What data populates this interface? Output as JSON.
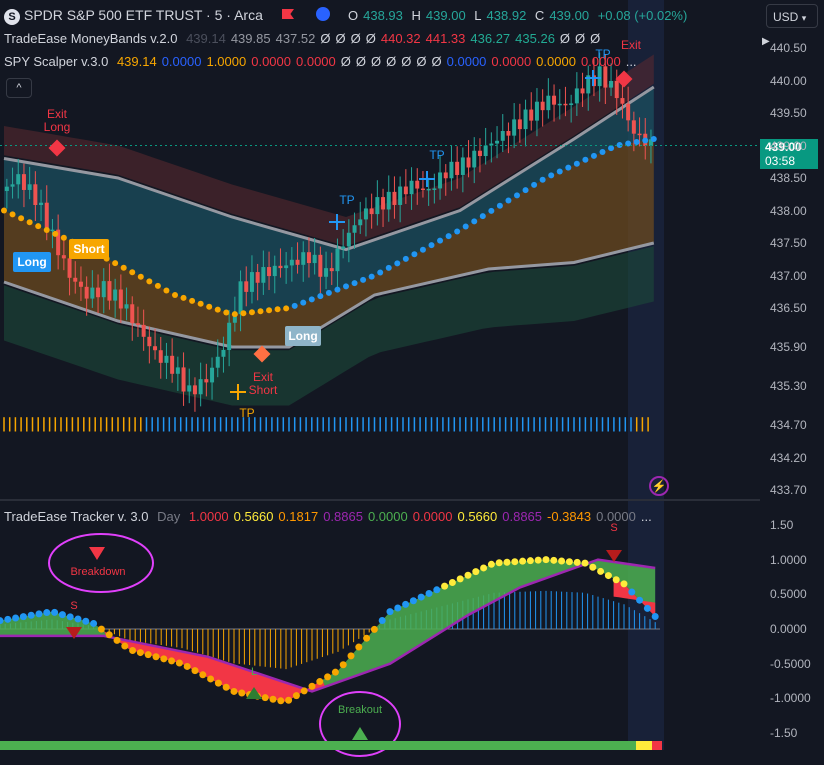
{
  "header": {
    "symbol_logo": "S",
    "symbol_title": "SPDR S&P 500 ETF TRUST · 5 · Arca",
    "ohlc": [
      {
        "key": "O",
        "value": "438.93"
      },
      {
        "key": "H",
        "value": "439.00"
      },
      {
        "key": "L",
        "value": "438.92"
      },
      {
        "key": "C",
        "value": "439.00"
      }
    ],
    "change": "+0.08 (+0.02%)"
  },
  "indicators": [
    {
      "name": "TradeEase MoneyBands v.2.0",
      "values": [
        {
          "text": "439.14",
          "color": "#4b4f5c"
        },
        {
          "text": "439.85",
          "color": "#9598a1"
        },
        {
          "text": "437.52",
          "color": "#9598a1"
        },
        {
          "text": "Ø",
          "color": "#d1d4dc"
        },
        {
          "text": "Ø",
          "color": "#d1d4dc"
        },
        {
          "text": "Ø",
          "color": "#d1d4dc"
        },
        {
          "text": "Ø",
          "color": "#d1d4dc"
        },
        {
          "text": "440.32",
          "color": "#f23645"
        },
        {
          "text": "441.33",
          "color": "#f23645"
        },
        {
          "text": "436.27",
          "color": "#22ab94"
        },
        {
          "text": "435.26",
          "color": "#22ab94"
        },
        {
          "text": "Ø",
          "color": "#d1d4dc"
        },
        {
          "text": "Ø",
          "color": "#d1d4dc"
        },
        {
          "text": "Ø",
          "color": "#d1d4dc"
        }
      ]
    },
    {
      "name": "SPY Scalper v.3.0",
      "values": [
        {
          "text": "439.14",
          "color": "#f7a600"
        },
        {
          "text": "0.0000",
          "color": "#2962ff"
        },
        {
          "text": "1.0000",
          "color": "#f7a600"
        },
        {
          "text": "0.0000",
          "color": "#f23645"
        },
        {
          "text": "0.0000",
          "color": "#f23645"
        },
        {
          "text": "Ø",
          "color": "#d1d4dc"
        },
        {
          "text": "Ø",
          "color": "#d1d4dc"
        },
        {
          "text": "Ø",
          "color": "#d1d4dc"
        },
        {
          "text": "Ø",
          "color": "#d1d4dc"
        },
        {
          "text": "Ø",
          "color": "#d1d4dc"
        },
        {
          "text": "Ø",
          "color": "#d1d4dc"
        },
        {
          "text": "Ø",
          "color": "#d1d4dc"
        },
        {
          "text": "0.0000",
          "color": "#2962ff"
        },
        {
          "text": "0.0000",
          "color": "#f23645"
        },
        {
          "text": "0.0000",
          "color": "#f7a600"
        },
        {
          "text": "0.0000",
          "color": "#f23645"
        },
        {
          "text": "...",
          "color": "#d1d4dc"
        }
      ]
    },
    {
      "name": "TradeEase Tracker v. 3.0",
      "timeframe": "Day",
      "values": [
        {
          "text": "1.0000",
          "color": "#f23645"
        },
        {
          "text": "0.5660",
          "color": "#ffeb3b"
        },
        {
          "text": "0.1817",
          "color": "#ff9800"
        },
        {
          "text": "0.8865",
          "color": "#9c27b0"
        },
        {
          "text": "0.0000",
          "color": "#4caf50"
        },
        {
          "text": "0.0000",
          "color": "#f23645"
        },
        {
          "text": "0.5660",
          "color": "#ffeb3b"
        },
        {
          "text": "0.8865",
          "color": "#9c27b0"
        },
        {
          "text": "-0.3843",
          "color": "#ff9800"
        },
        {
          "text": "0.0000",
          "color": "#787b86"
        },
        {
          "text": "...",
          "color": "#d1d4dc"
        }
      ]
    }
  ],
  "currency_button": "USD",
  "collapse_button": "^",
  "last_price": {
    "value": "439.00",
    "countdown": "03:58"
  },
  "chart_data": [
    {
      "type": "candlestick",
      "title": "SPDR S&P 500 ETF TRUST · 5 · Arca",
      "ylim": [
        433.7,
        440.5
      ],
      "price_ticks": [
        "440.50",
        "440.00",
        "439.50",
        "439.00",
        "438.50",
        "438.00",
        "437.50",
        "437.00",
        "436.50",
        "435.90",
        "435.30",
        "434.70",
        "434.20",
        "433.70"
      ],
      "price_tick_values": [
        440.5,
        440.0,
        439.5,
        439.0,
        438.5,
        438.0,
        437.5,
        437.0,
        436.5,
        435.9,
        435.3,
        434.7,
        434.2,
        433.7
      ],
      "close_path": [
        [
          0,
          438.3
        ],
        [
          6,
          438.5
        ],
        [
          12,
          438.2
        ],
        [
          18,
          437.6
        ],
        [
          24,
          437.0
        ],
        [
          30,
          436.7
        ],
        [
          36,
          436.8
        ],
        [
          42,
          436.6
        ],
        [
          48,
          436.2
        ],
        [
          54,
          435.8
        ],
        [
          60,
          435.6
        ],
        [
          66,
          435.2
        ],
        [
          72,
          435.4
        ],
        [
          78,
          435.9
        ],
        [
          84,
          436.8
        ],
        [
          90,
          437.0
        ],
        [
          96,
          437.1
        ],
        [
          102,
          437.2
        ],
        [
          108,
          437.3
        ],
        [
          114,
          437.0
        ],
        [
          120,
          437.5
        ],
        [
          126,
          437.9
        ],
        [
          132,
          438.1
        ],
        [
          138,
          438.2
        ],
        [
          144,
          438.4
        ],
        [
          150,
          438.3
        ],
        [
          156,
          438.6
        ],
        [
          162,
          438.7
        ],
        [
          168,
          438.9
        ],
        [
          174,
          439.1
        ],
        [
          180,
          439.3
        ],
        [
          186,
          439.5
        ],
        [
          192,
          439.7
        ],
        [
          198,
          439.6
        ],
        [
          204,
          439.9
        ],
        [
          210,
          440.1
        ],
        [
          216,
          439.8
        ],
        [
          222,
          439.2
        ],
        [
          228,
          439.0
        ]
      ],
      "ribbon_upper": [
        [
          0,
          438.8
        ],
        [
          40,
          438.5
        ],
        [
          80,
          437.9
        ],
        [
          120,
          437.4
        ],
        [
          160,
          438.0
        ],
        [
          200,
          439.1
        ],
        [
          228,
          439.9
        ]
      ],
      "ribbon_lower": [
        [
          0,
          436.9
        ],
        [
          40,
          436.3
        ],
        [
          80,
          435.9
        ],
        [
          100,
          435.9
        ],
        [
          130,
          436.7
        ],
        [
          170,
          437.1
        ],
        [
          200,
          437.2
        ],
        [
          228,
          437.5
        ]
      ],
      "dots_series": [
        [
          0,
          438.0
        ],
        [
          30,
          437.4
        ],
        [
          60,
          436.7
        ],
        [
          80,
          436.4
        ],
        [
          100,
          436.5
        ],
        [
          130,
          437.0
        ],
        [
          160,
          437.7
        ],
        [
          190,
          438.5
        ],
        [
          215,
          439.0
        ],
        [
          228,
          439.1
        ]
      ],
      "signals": [
        {
          "label": "Exit Long",
          "kind": "exit"
        },
        {
          "label": "Long",
          "kind": "long"
        },
        {
          "label": "Short",
          "kind": "short"
        },
        {
          "label": "Exit Short",
          "kind": "exit"
        },
        {
          "label": "TP",
          "kind": "tp"
        },
        {
          "label": "Long",
          "kind": "long"
        },
        {
          "label": "TP",
          "kind": "tp"
        },
        {
          "label": "TP",
          "kind": "tp"
        },
        {
          "label": "TP",
          "kind": "tp"
        },
        {
          "label": "Exit",
          "kind": "exit"
        }
      ]
    },
    {
      "type": "area",
      "title": "TradeEase Tracker v. 3.0",
      "ylim": [
        -1.6,
        1.6
      ],
      "ticks": [
        "1.50",
        "1.0000",
        "0.5000",
        "0.0000",
        "-0.5000",
        "-1.0000",
        "-1.50"
      ],
      "tick_values": [
        1.5,
        1.0,
        0.5,
        0.0,
        -0.5,
        -1.0,
        -1.5
      ],
      "oscillator": [
        [
          0,
          0.12
        ],
        [
          20,
          0.25
        ],
        [
          36,
          0.08
        ],
        [
          50,
          -0.3
        ],
        [
          70,
          -0.5
        ],
        [
          90,
          -0.9
        ],
        [
          110,
          -1.05
        ],
        [
          130,
          -0.6
        ],
        [
          150,
          0.25
        ],
        [
          170,
          0.6
        ],
        [
          190,
          0.95
        ],
        [
          210,
          1.0
        ],
        [
          225,
          0.95
        ],
        [
          240,
          0.65
        ],
        [
          252,
          0.18
        ]
      ],
      "signal_line": [
        [
          0,
          -0.1
        ],
        [
          40,
          -0.1
        ],
        [
          80,
          -0.4
        ],
        [
          120,
          -0.9
        ],
        [
          150,
          -0.5
        ],
        [
          180,
          0.2
        ],
        [
          200,
          0.6
        ],
        [
          230,
          1.0
        ],
        [
          252,
          0.88
        ]
      ],
      "annotations": [
        {
          "label": "Breakdown"
        },
        {
          "label": "Breakout"
        },
        {
          "label": "S"
        },
        {
          "label": "L"
        },
        {
          "label": "S"
        }
      ]
    }
  ],
  "colors": {
    "background": "#131722",
    "up": "#26a69a",
    "down": "#ef5350",
    "band_red": "#5c2a30",
    "band_green": "#1d4a3a",
    "cyan_fill": "#1b4f5f",
    "orange_fill": "#6b4a1f",
    "dot_orange": "#f7a600",
    "dot_cyan": "#2196f3",
    "oscillator_green": "#4caf50",
    "oscillator_red": "#f23645",
    "signal_line": "#9c27b0",
    "annotation_circle": "#e040fb"
  }
}
